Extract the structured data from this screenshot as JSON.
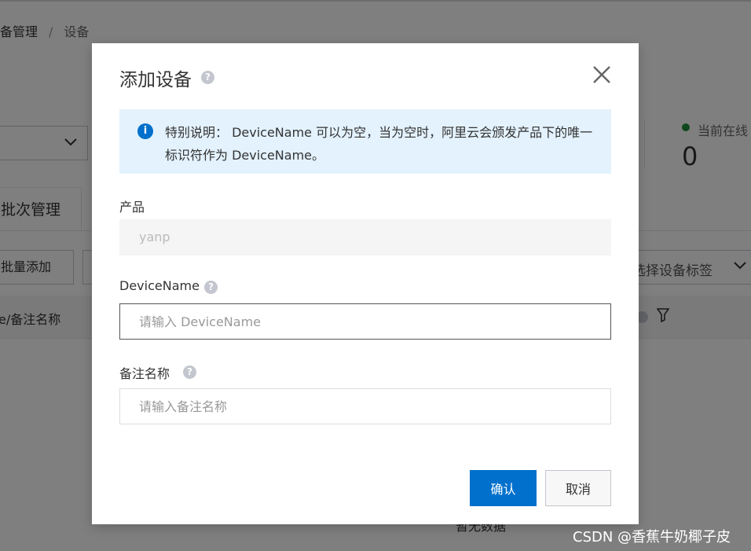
{
  "background": {
    "breadcrumb_first": "备管理",
    "breadcrumb_sep": "/",
    "breadcrumb_last": "设备",
    "online_label": "当前在线",
    "online_count": "0",
    "tab_batch": "批次管理",
    "button_batch_add": "批量添加",
    "tag_select_text": "选择设备标签",
    "column_header": "e/备注名称",
    "no_data": "暂无数据"
  },
  "dialog": {
    "title": "添加设备",
    "notice": "特别说明： DeviceName 可以为空，当为空时，阿里云会颁发产品下的唯一标识符作为 DeviceName。",
    "product_label": "产品",
    "product_value": "yanp",
    "devicename_label": "DeviceName",
    "devicename_placeholder": "请输入 DeviceName",
    "remark_label": "备注名称",
    "remark_placeholder": "请输入备注名称",
    "confirm_label": "确认",
    "cancel_label": "取消"
  },
  "watermark": "CSDN @香蕉牛奶椰子皮",
  "colors": {
    "primary": "#0070cc",
    "notice_bg": "#e3f2fd",
    "online_dot": "#1e8e3e"
  },
  "icons": [
    "help-icon",
    "close-icon",
    "info-icon",
    "chevron-down-icon",
    "filter-icon"
  ]
}
